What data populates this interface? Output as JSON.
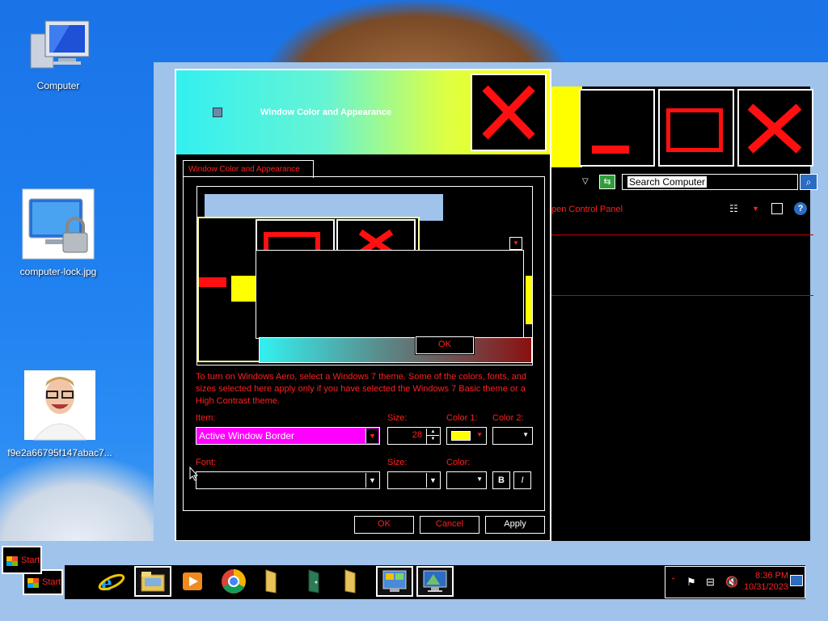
{
  "desktop": {
    "icons": [
      {
        "label": "Computer",
        "icon": "computer-icon"
      },
      {
        "label": "computer-lock.jpg",
        "icon": "image-file-icon"
      },
      {
        "label": "f9e2a66795f147abac7...",
        "icon": "photo-thumbnail-icon"
      }
    ]
  },
  "explorer": {
    "search_placeholder": "Search Computer",
    "breadcrumb_partial": "pen Control Panel"
  },
  "dialog": {
    "title": "Window Color and Appearance",
    "tab_label": "Window Color and Appearance",
    "preview_ok_label": "OK",
    "description": "To turn on Windows Aero, select a Windows 7 theme.  Some of the colors, fonts, and sizes selected here apply only if you have selected the Windows 7 Basic theme or a High Contrast theme.",
    "item_label": "Item:",
    "item_value": "Active Window Border",
    "size_label": "Size:",
    "size_value": "28",
    "color1_label": "Color 1:",
    "color1_value": "#ffff00",
    "color2_label": "Color 2:",
    "font_label": "Font:",
    "font_size_label": "Size:",
    "font_color_label": "Color:",
    "bold_label": "B",
    "italic_label": "I",
    "ok_label": "OK",
    "cancel_label": "Cancel",
    "apply_label": "Apply"
  },
  "taskbar": {
    "start_label": "Start",
    "start_label_overlay": "Start",
    "items": [
      {
        "icon": "internet-explorer-icon"
      },
      {
        "icon": "file-explorer-icon"
      },
      {
        "icon": "media-player-icon"
      },
      {
        "icon": "chrome-icon"
      },
      {
        "icon": "folder-icon"
      },
      {
        "icon": "door-exit-icon"
      },
      {
        "icon": "folder-icon"
      },
      {
        "icon": "control-panel-icon"
      },
      {
        "icon": "display-settings-icon"
      }
    ],
    "clock_time": "8:36 PM",
    "clock_date": "10/31/2023"
  },
  "colors": {
    "accent_red": "#ff2020",
    "highlight_magenta": "#ff00ff",
    "title_cyan": "#33f0f0",
    "title_yellow": "#ffff00"
  }
}
